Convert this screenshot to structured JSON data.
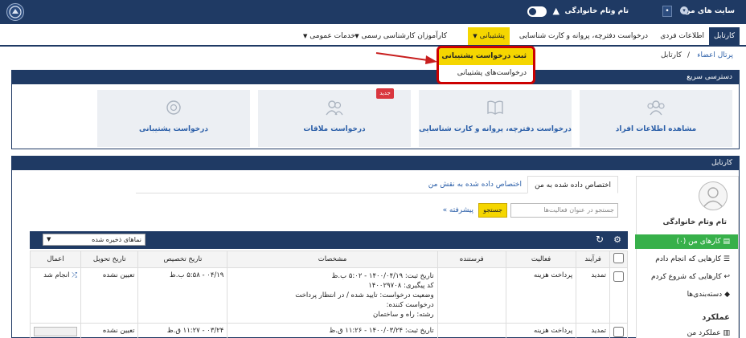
{
  "topbar": {
    "site_title": "سایت های من",
    "user_name": "تام وتام خانوادگی",
    "dot": "•"
  },
  "nav": {
    "tabs": [
      {
        "label": "کارتابل"
      },
      {
        "label": "اطلاعات فردی"
      },
      {
        "label": "درخواست دفترچه، پروانه و کارت شناسایی"
      },
      {
        "label": "پشتیبانی"
      },
      {
        "label": "کارآموزان کارشناسی رسمی"
      },
      {
        "label": "خدمات عمومی"
      }
    ],
    "dropdown": [
      {
        "label": "ثبت درخواست پشتیبانی"
      },
      {
        "label": "درخواست‌های پشتیبانی"
      }
    ]
  },
  "breadcrumb": {
    "root": "پرتال اعضاء",
    "sep": "/",
    "current": "کارتابل"
  },
  "quick_access": {
    "title": "دسترسی سریع",
    "new_badge": "جدید",
    "cards": [
      {
        "label": "مشاهده اطلاعات افراد",
        "icon": "users-icon"
      },
      {
        "label": "درخواست دفترچه، پروانه و کارت شناسایی",
        "icon": "book-icon"
      },
      {
        "label": "درخواست ملاقات",
        "icon": "meeting-icon"
      },
      {
        "label": "درخواست پشتیبانی",
        "icon": "lifebuoy-icon"
      }
    ]
  },
  "cartable": {
    "title": "کارتابل",
    "user": "تام وتام خانوادگی",
    "menu": [
      {
        "label": "کارهای من (۰)"
      },
      {
        "label": "کارهایی که انجام دادم"
      },
      {
        "label": "کارهایی که شروع کردم"
      },
      {
        "label": "دسته‌بندی‌ها"
      }
    ],
    "performance_title": "عملکرد",
    "performance_item": "عملکرد من",
    "subtabs": [
      {
        "label": "اختصاص داده شده به من"
      },
      {
        "label": "اختصاص داده شده به نقش من"
      }
    ],
    "search_placeholder": "جستجو در عنوان فعالیت‌ها",
    "search_button": "جستجو",
    "advanced": "پیشرفته »",
    "saved_views": "نماهای ذخیره شده",
    "columns": [
      "فرآیند",
      "فعالیت",
      "فرستنده",
      "مشخصات",
      "تاریخ تخصیص",
      "تاریخ تحویل",
      "اعمال"
    ],
    "rows": [
      {
        "process": "تمدید",
        "activity": "پرداخت هزینه",
        "sender": "",
        "details": [
          "تاریخ ثبت: ۱۴۰۰/۰۴/۱۹ - ۵:۰۲ ب.ظ",
          "کد پیگیری: ۱۴۰۰۲۹۷۰۸",
          "وضعیت درخواست: تایید شده / در انتظار پرداخت",
          "درخواست کننده:",
          "رشته: راه و ساختمان"
        ],
        "assigned": "۰۴/۱۹ - ۵:۵۸ ب.ظ",
        "due": "تعیین نشده",
        "action": "انجام شد"
      },
      {
        "process": "تمدید",
        "activity": "پرداخت هزینه",
        "sender": "",
        "details": [
          "تاریخ ثبت: ۱۴۰۰/۰۳/۲۴ - ۱۱:۲۶ ق.ظ"
        ],
        "assigned": "۰۳/۲۴ - ۱۱:۲۷ ق.ظ",
        "due": "تعیین نشده",
        "action": ""
      }
    ]
  }
}
